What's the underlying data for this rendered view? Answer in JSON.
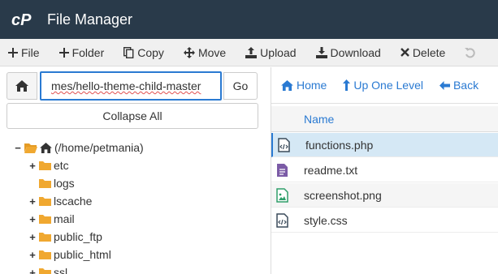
{
  "app": {
    "title": "File Manager"
  },
  "toolbar": {
    "items": [
      {
        "label": "File",
        "icon": "plus-icon"
      },
      {
        "label": "Folder",
        "icon": "plus-icon"
      },
      {
        "label": "Copy",
        "icon": "copy-icon"
      },
      {
        "label": "Move",
        "icon": "move-icon"
      },
      {
        "label": "Upload",
        "icon": "upload-icon"
      },
      {
        "label": "Download",
        "icon": "download-icon"
      },
      {
        "label": "Delete",
        "icon": "close-icon"
      }
    ]
  },
  "path": {
    "value": "mes/hello-theme-child-master",
    "go_label": "Go"
  },
  "collapse_label": "Collapse All",
  "tree": {
    "root": {
      "label": "(/home/petmania)",
      "toggle": "−"
    },
    "items": [
      {
        "label": "etc",
        "toggle": "+"
      },
      {
        "label": "logs",
        "toggle": ""
      },
      {
        "label": "lscache",
        "toggle": "+"
      },
      {
        "label": "mail",
        "toggle": "+"
      },
      {
        "label": "public_ftp",
        "toggle": "+"
      },
      {
        "label": "public_html",
        "toggle": "+"
      },
      {
        "label": "ssl",
        "toggle": "+"
      }
    ]
  },
  "nav": {
    "home_label": "Home",
    "up_label": "Up One Level",
    "back_label": "Back"
  },
  "files": {
    "column_name": "Name",
    "rows": [
      {
        "name": "functions.php",
        "icon": "code-file-icon",
        "selected": true
      },
      {
        "name": "readme.txt",
        "icon": "text-file-icon",
        "selected": false
      },
      {
        "name": "screenshot.png",
        "icon": "image-file-icon",
        "selected": false
      },
      {
        "name": "style.css",
        "icon": "code-file-icon",
        "selected": false
      }
    ]
  },
  "colors": {
    "header_bg": "#293a4a",
    "accent": "#2a7ad2",
    "folder": "#f0a830",
    "selected_row": "#d5e8f5"
  }
}
